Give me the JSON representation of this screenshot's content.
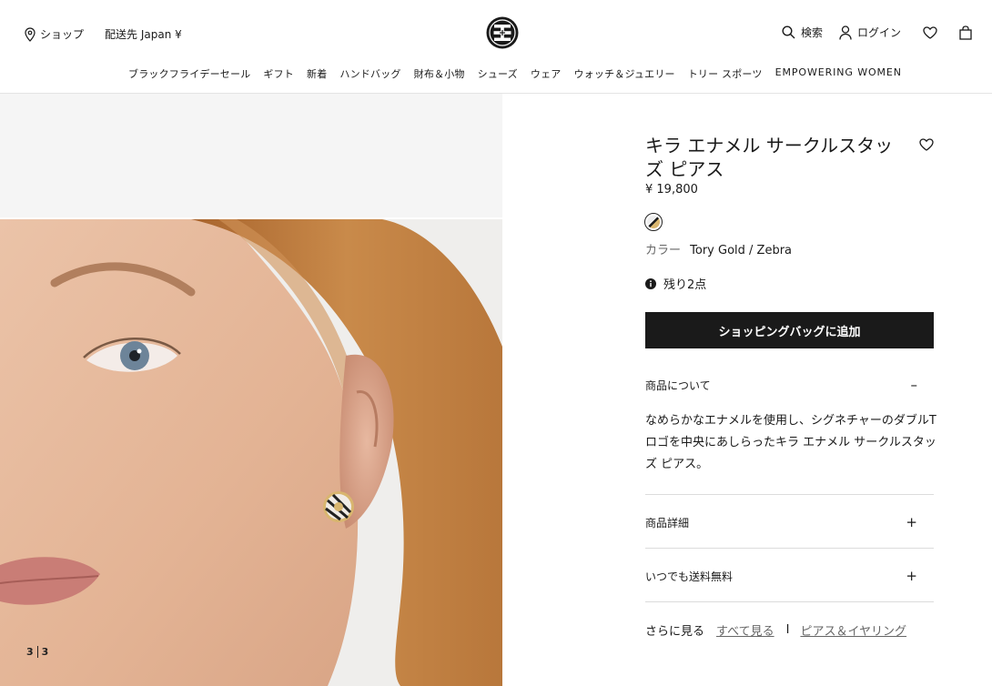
{
  "header": {
    "shop_label": "ショップ",
    "shipping_label": "配送先 Japan ¥",
    "search_label": "検索",
    "login_label": "ログイン"
  },
  "nav": [
    "ブラックフライデーセール",
    "ギフト",
    "新着",
    "ハンドバッグ",
    "財布＆小物",
    "シューズ",
    "ウェア",
    "ウォッチ＆ジュエリー",
    "トリー スポーツ",
    "EMPOWERING WOMEN"
  ],
  "gallery": {
    "current": "3",
    "total": "3"
  },
  "product": {
    "title": "キラ エナメル サークルスタッズ ピアス",
    "price": "¥ 19,800",
    "color_label": "カラー",
    "color_value": "Tory Gold / Zebra",
    "stock_text": "残り2点",
    "add_to_bag": "ショッピングバッグに追加",
    "about_title": "商品について",
    "description": "なめらかなエナメルを使用し、シグネチャーのダブルTロゴを中央にあしらったキラ エナメル サークルスタッズ ピアス。",
    "details_title": "商品詳細",
    "shipping_title": "いつでも送料無料",
    "see_more_label": "さらに見る",
    "see_all_link": "すべて見る",
    "category_link": "ピアス＆イヤリング",
    "link_divider": "I"
  },
  "colors": {
    "text": "#1a1a1a",
    "button_bg": "#1a1a1a",
    "gallery_bg": "#f5f5f5",
    "link": "#666666"
  }
}
